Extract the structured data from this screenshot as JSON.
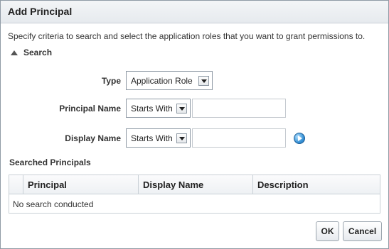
{
  "dialog": {
    "title": "Add Principal",
    "instructions": "Specify criteria to search and select the application roles that you want to grant permissions to."
  },
  "search": {
    "header": "Search",
    "type_label": "Type",
    "type_value": "Application Role",
    "principal_name_label": "Principal Name",
    "principal_name_operator": "Starts With",
    "principal_name_value": "",
    "display_name_label": "Display Name",
    "display_name_operator": "Starts With",
    "display_name_value": ""
  },
  "results": {
    "title": "Searched Principals",
    "columns": [
      "Principal",
      "Display Name",
      "Description"
    ],
    "empty_message": "No search conducted"
  },
  "buttons": {
    "ok": "OK",
    "cancel": "Cancel"
  },
  "icons": {
    "search_go": "go-arrow-icon",
    "section_toggle": "disclosure-triangle-icon"
  }
}
